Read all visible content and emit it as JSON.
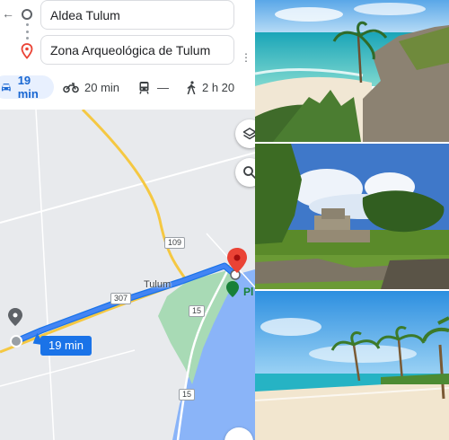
{
  "route": {
    "origin": "Aldea Tulum",
    "destination": "Zona Arqueológica de Tulum"
  },
  "travel_modes": [
    {
      "mode": "car",
      "label": "19 min",
      "selected": true
    },
    {
      "mode": "motorcycle",
      "label": "20 min",
      "selected": false
    },
    {
      "mode": "transit",
      "label": "—",
      "selected": false
    },
    {
      "mode": "walk",
      "label": "2 h 20",
      "selected": false
    }
  ],
  "map": {
    "route_duration": "19 min",
    "place_label": "Tulum",
    "poi_label_partial": "Pl",
    "left_label_partial": "n\ne",
    "road_shields": [
      "109",
      "307",
      "15",
      "15"
    ]
  },
  "colors": {
    "route": "#4285f4",
    "accent": "#1a73e8",
    "destination_pin": "#ea4335",
    "park": "#a8dab5",
    "water": "#8ab4f8",
    "land": "#e8eaed",
    "road": "#f5c842"
  },
  "photos": [
    {
      "name": "beach-cliff-photo"
    },
    {
      "name": "ruins-photo"
    },
    {
      "name": "beach-palms-photo"
    }
  ]
}
